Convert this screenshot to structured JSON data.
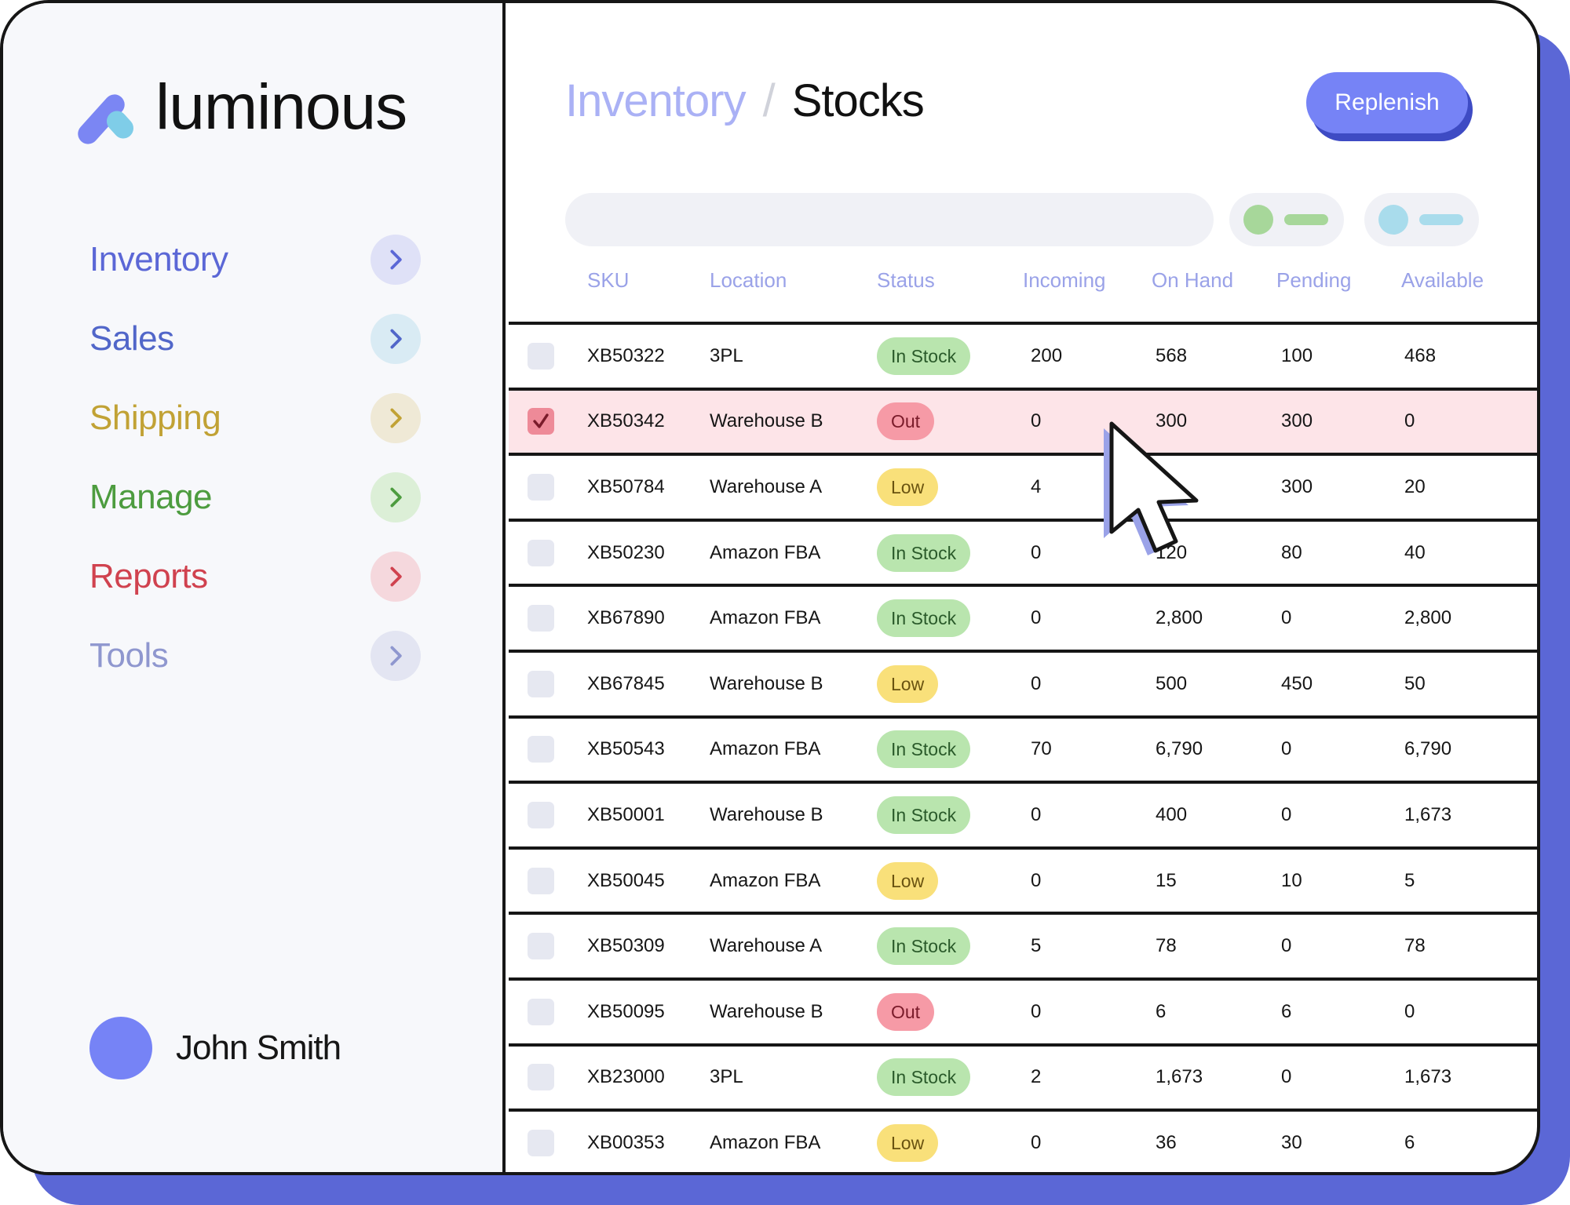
{
  "brand": {
    "name": "luminous"
  },
  "sidebar": {
    "items": [
      {
        "label": "Inventory",
        "color": "#5b67d6",
        "chevron_bg": "#dfe1f7",
        "chevron_color": "#5b67d6"
      },
      {
        "label": "Sales",
        "color": "#5166c9",
        "chevron_bg": "#d9ebf4",
        "chevron_color": "#5166c9"
      },
      {
        "label": "Shipping",
        "color": "#c1a235",
        "chevron_bg": "#efe9d6",
        "chevron_color": "#c1a235"
      },
      {
        "label": "Manage",
        "color": "#4d9c3f",
        "chevron_bg": "#dcefd7",
        "chevron_color": "#4d9c3f"
      },
      {
        "label": "Reports",
        "color": "#d0424f",
        "chevron_bg": "#f5d8dd",
        "chevron_color": "#d0424f"
      },
      {
        "label": "Tools",
        "color": "#8f97cf",
        "chevron_bg": "#e3e5f2",
        "chevron_color": "#8f97cf"
      }
    ]
  },
  "user": {
    "name": "John Smith"
  },
  "header": {
    "breadcrumb_parent": "Inventory",
    "breadcrumb_separator": "/",
    "breadcrumb_current": "Stocks",
    "replenish_label": "Replenish"
  },
  "search": {
    "value": "",
    "placeholder": ""
  },
  "filters": [
    {
      "dot_color": "#a7d79a",
      "line_color": "#a7d79a"
    },
    {
      "dot_color": "#a9dcec",
      "line_color": "#a9dcec"
    }
  ],
  "table": {
    "columns": [
      "SKU",
      "Location",
      "Status",
      "Incoming",
      "On Hand",
      "Pending",
      "Available"
    ],
    "rows": [
      {
        "checked": false,
        "sku": "XB50322",
        "location": "3PL",
        "status": "In Stock",
        "incoming": "200",
        "on_hand": "568",
        "pending": "100",
        "available": "468"
      },
      {
        "checked": true,
        "sku": "XB50342",
        "location": "Warehouse B",
        "status": "Out",
        "incoming": "0",
        "on_hand": "300",
        "pending": "300",
        "available": "0"
      },
      {
        "checked": false,
        "sku": "XB50784",
        "location": "Warehouse A",
        "status": "Low",
        "incoming": "4",
        "on_hand": "",
        "pending": "300",
        "available": "20"
      },
      {
        "checked": false,
        "sku": "XB50230",
        "location": "Amazon FBA",
        "status": "In Stock",
        "incoming": "0",
        "on_hand": "120",
        "pending": "80",
        "available": "40"
      },
      {
        "checked": false,
        "sku": "XB67890",
        "location": "Amazon FBA",
        "status": "In Stock",
        "incoming": "0",
        "on_hand": "2,800",
        "pending": "0",
        "available": "2,800"
      },
      {
        "checked": false,
        "sku": "XB67845",
        "location": "Warehouse B",
        "status": "Low",
        "incoming": "0",
        "on_hand": "500",
        "pending": "450",
        "available": "50"
      },
      {
        "checked": false,
        "sku": "XB50543",
        "location": "Amazon FBA",
        "status": "In Stock",
        "incoming": "70",
        "on_hand": "6,790",
        "pending": "0",
        "available": "6,790"
      },
      {
        "checked": false,
        "sku": "XB50001",
        "location": "Warehouse B",
        "status": "In Stock",
        "incoming": "0",
        "on_hand": "400",
        "pending": "0",
        "available": "1,673"
      },
      {
        "checked": false,
        "sku": "XB50045",
        "location": "Amazon FBA",
        "status": "Low",
        "incoming": "0",
        "on_hand": "15",
        "pending": "10",
        "available": "5"
      },
      {
        "checked": false,
        "sku": "XB50309",
        "location": "Warehouse A",
        "status": "In Stock",
        "incoming": "5",
        "on_hand": "78",
        "pending": "0",
        "available": "78"
      },
      {
        "checked": false,
        "sku": "XB50095",
        "location": "Warehouse B",
        "status": "Out",
        "incoming": "0",
        "on_hand": "6",
        "pending": "6",
        "available": "0"
      },
      {
        "checked": false,
        "sku": "XB23000",
        "location": "3PL",
        "status": "In Stock",
        "incoming": "2",
        "on_hand": "1,673",
        "pending": "0",
        "available": "1,673"
      },
      {
        "checked": false,
        "sku": "XB00353",
        "location": "Amazon FBA",
        "status": "Low",
        "incoming": "0",
        "on_hand": "36",
        "pending": "30",
        "available": "6"
      }
    ]
  },
  "icons": {
    "nav_chevron": "chevron-right-icon",
    "checkbox_check": "check-icon",
    "pointer": "mouse-cursor-icon"
  },
  "colors": {
    "accent": "#7683f6",
    "accent_dark": "#3e4bc4",
    "frame_shadow": "#5b67d6",
    "selected_row": "#fde4e8"
  }
}
